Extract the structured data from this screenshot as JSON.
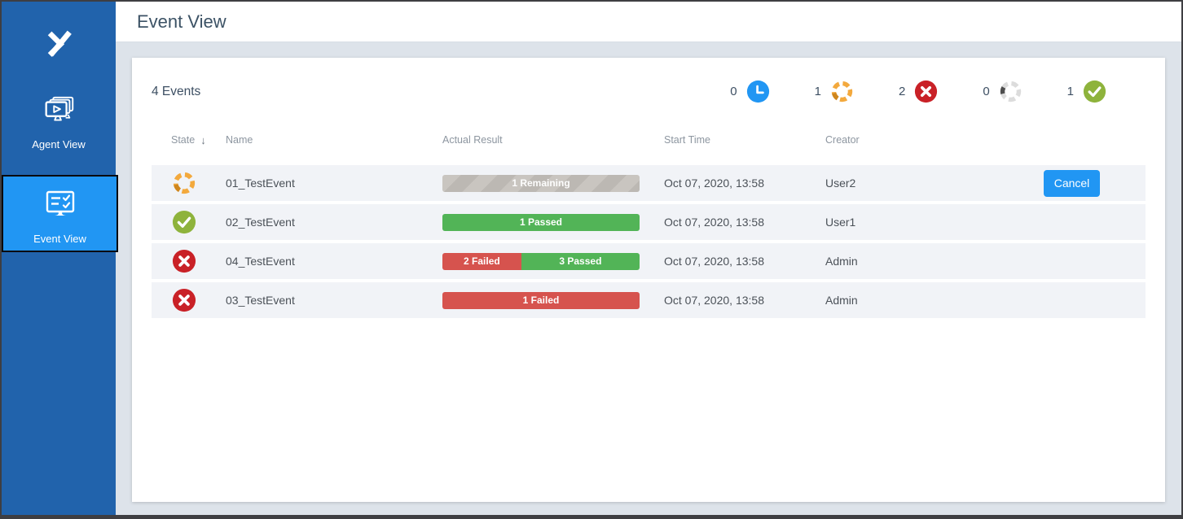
{
  "sidebar": {
    "items": [
      {
        "label": "Agent View",
        "selected": false
      },
      {
        "label": "Event View",
        "selected": true
      }
    ]
  },
  "header": {
    "title": "Event View"
  },
  "card": {
    "events_count": "4 Events",
    "counters": [
      {
        "state": "pending",
        "count": "0",
        "icon": "clock-icon"
      },
      {
        "state": "running",
        "count": "1",
        "icon": "running-spinner-icon"
      },
      {
        "state": "failed",
        "count": "2",
        "icon": "failed-circle-icon"
      },
      {
        "state": "canceled",
        "count": "0",
        "icon": "canceled-spinner-icon"
      },
      {
        "state": "passed",
        "count": "1",
        "icon": "passed-circle-icon"
      }
    ],
    "table": {
      "headers": {
        "state": "State",
        "name": "Name",
        "result": "Actual Result",
        "start": "Start Time",
        "creator": "Creator"
      },
      "sort": {
        "column": "State",
        "direction": "desc",
        "icon": "↓"
      },
      "rows": [
        {
          "state": "running",
          "name": "01_TestEvent",
          "start_time": "Oct 07, 2020, 13:58",
          "creator": "User2",
          "action": "Cancel",
          "result": {
            "segments": [
              {
                "type": "remaining",
                "label": "1 Remaining",
                "percent": 100
              }
            ]
          }
        },
        {
          "state": "passed",
          "name": "02_TestEvent",
          "start_time": "Oct 07, 2020, 13:58",
          "creator": "User1",
          "result": {
            "segments": [
              {
                "type": "passed",
                "label": "1 Passed",
                "percent": 100
              }
            ]
          }
        },
        {
          "state": "failed",
          "name": "04_TestEvent",
          "start_time": "Oct 07, 2020, 13:58",
          "creator": "Admin",
          "result": {
            "segments": [
              {
                "type": "failed",
                "label": "2 Failed",
                "percent": 40
              },
              {
                "type": "passed",
                "label": "3 Passed",
                "percent": 60
              }
            ]
          }
        },
        {
          "state": "failed",
          "name": "03_TestEvent",
          "start_time": "Oct 07, 2020, 13:58",
          "creator": "Admin",
          "result": {
            "segments": [
              {
                "type": "failed",
                "label": "1 Failed",
                "percent": 100
              }
            ]
          }
        }
      ]
    }
  },
  "colors": {
    "sidebar": "#2163ac",
    "selected_item": "#2196f3",
    "accent_blue": "#2196f3",
    "passed_icon": "#8eb33c",
    "failed_icon": "#c92127",
    "running_icon": "#f3a93d",
    "running_icon_dark": "#cf861d",
    "canceled_icon": "#dcdcdc",
    "canceled_icon_dark": "#4e4e4e",
    "passed_bar": "#52b457",
    "failed_bar": "#d6534e",
    "remaining_bar": "#c2beb9",
    "row_bg": "#f1f3f7",
    "content_bg": "#dde3ea"
  }
}
